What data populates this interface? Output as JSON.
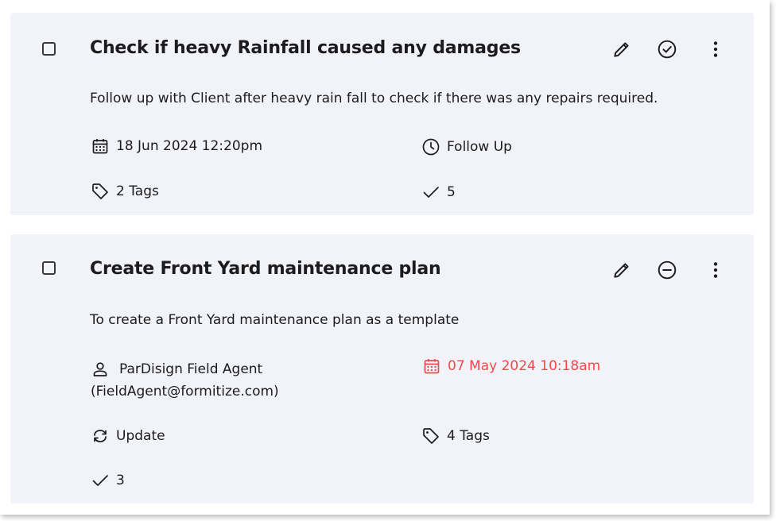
{
  "tasks": [
    {
      "title": "Check if heavy Rainfall caused any damages",
      "description": "Follow up with Client after heavy rain fall to check if there was any repairs required.",
      "due_date": "18 Jun 2024 12:20pm",
      "type": "Follow Up",
      "tags": "2 Tags",
      "checks": "5",
      "status_icon": "check-circle-icon"
    },
    {
      "title": "Create Front Yard maintenance plan",
      "description": "To create a Front Yard maintenance plan as a template",
      "assignee_name": "ParDisign Field Agent",
      "assignee_email": "(FieldAgent@formitize.com)",
      "due_date": "07 May 2024 10:18am",
      "type": "Update",
      "tags": "4 Tags",
      "checks": "3",
      "status_icon": "minus-circle-icon"
    }
  ],
  "colors": {
    "card_bg": "#f2f3f8",
    "text": "#1c1c1e",
    "overdue": "#ef4a4a"
  }
}
